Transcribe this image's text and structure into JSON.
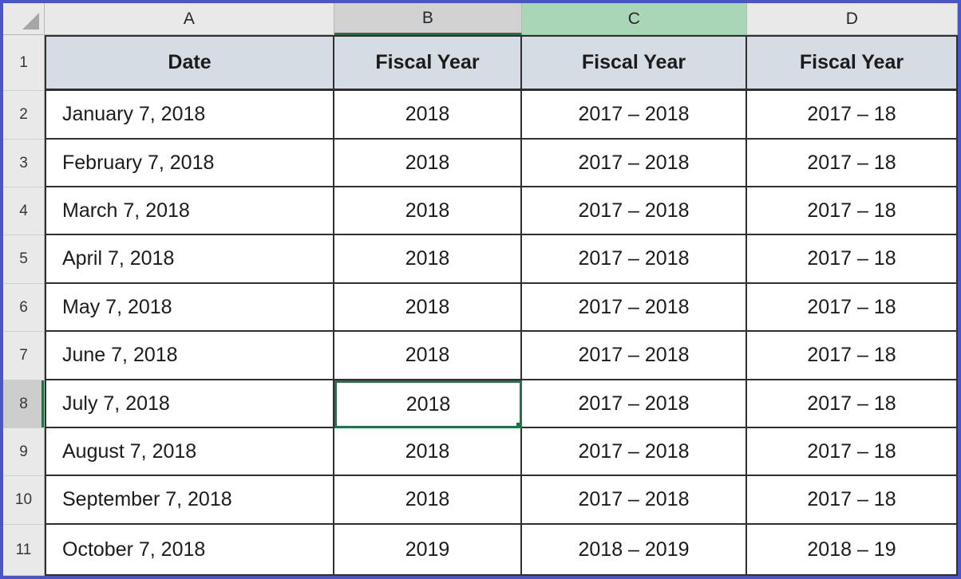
{
  "app": {
    "type": "spreadsheet",
    "select_all_icon": "select-all-triangle-icon"
  },
  "colors": {
    "frame_border": "#4a55c8",
    "column_header_bg": "#e9e9e9",
    "active_column_bg": "#d2d2d2",
    "highlight_column_bg": "#a9d6b6",
    "table_header_bg": "#d6dce4",
    "selection_green": "#217346",
    "fill_handle": "#1e7145",
    "cell_border": "#2f2f2f"
  },
  "column_headers": [
    {
      "label": "A",
      "state": "normal"
    },
    {
      "label": "B",
      "state": "active"
    },
    {
      "label": "C",
      "state": "highlighted"
    },
    {
      "label": "D",
      "state": "normal"
    }
  ],
  "row_headers": [
    {
      "label": "1",
      "state": "normal"
    },
    {
      "label": "2",
      "state": "normal"
    },
    {
      "label": "3",
      "state": "normal"
    },
    {
      "label": "4",
      "state": "normal"
    },
    {
      "label": "5",
      "state": "normal"
    },
    {
      "label": "6",
      "state": "normal"
    },
    {
      "label": "7",
      "state": "normal"
    },
    {
      "label": "8",
      "state": "active"
    },
    {
      "label": "9",
      "state": "normal"
    },
    {
      "label": "10",
      "state": "normal"
    },
    {
      "label": "11",
      "state": "normal"
    }
  ],
  "selection": {
    "active_cell": "B8",
    "value": "2018"
  },
  "table": {
    "headers": [
      "Date",
      "Fiscal Year",
      "Fiscal Year",
      "Fiscal Year"
    ],
    "rows": [
      [
        "January 7, 2018",
        "2018",
        "2017 – 2018",
        "2017 – 18"
      ],
      [
        "February 7, 2018",
        "2018",
        "2017 – 2018",
        "2017 – 18"
      ],
      [
        "March 7, 2018",
        "2018",
        "2017 – 2018",
        "2017 – 18"
      ],
      [
        "April 7, 2018",
        "2018",
        "2017 – 2018",
        "2017 – 18"
      ],
      [
        "May 7, 2018",
        "2018",
        "2017 – 2018",
        "2017 – 18"
      ],
      [
        "June 7, 2018",
        "2018",
        "2017 – 2018",
        "2017 – 18"
      ],
      [
        "July 7, 2018",
        "2018",
        "2017 – 2018",
        "2017 – 18"
      ],
      [
        "August 7, 2018",
        "2018",
        "2017 – 2018",
        "2017 – 18"
      ],
      [
        "September 7, 2018",
        "2018",
        "2017 – 2018",
        "2017 – 18"
      ],
      [
        "October 7, 2018",
        "2019",
        "2018 – 2019",
        "2018 – 19"
      ]
    ]
  }
}
